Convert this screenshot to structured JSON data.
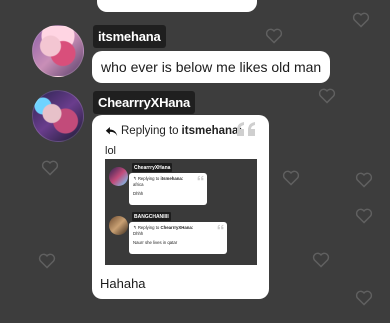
{
  "messages": [
    {
      "author": "itsmehana",
      "text": "who ever is below me likes old man"
    },
    {
      "author": "ChearrryXHana",
      "reply": {
        "prefix": "Replying to",
        "target": "itsmehana:",
        "text": "lol"
      },
      "screenshot": {
        "items": [
          {
            "author": "ChearrryXHana",
            "reply_prefix": "Replying to",
            "reply_target": "itsmehana:",
            "reply_text": "africa",
            "text": "Dhhh"
          },
          {
            "author": "BANGCHANIIII",
            "reply_prefix": "Replying to",
            "reply_target": "ChearrryXHana:",
            "reply_text": "Dhhh",
            "text": "Naurr she lives in qatar"
          }
        ]
      },
      "text": "Hahaha"
    }
  ],
  "icons": {
    "reply": "reply-arrow-icon",
    "quote": "quote-icon",
    "background": "heart-icon"
  },
  "colors": {
    "background": "#3d3d3d",
    "bubble": "#ffffff",
    "name_tag": "#1f1f1f"
  }
}
